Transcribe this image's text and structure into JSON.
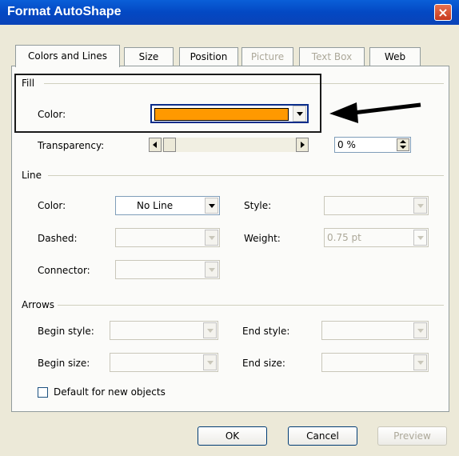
{
  "window": {
    "title": "Format AutoShape",
    "close_glyph": "×"
  },
  "tabs": [
    {
      "label": "Colors and Lines",
      "active": true
    },
    {
      "label": "Size"
    },
    {
      "label": "Position"
    },
    {
      "label": "Picture",
      "disabled": true
    },
    {
      "label": "Text Box",
      "disabled": true
    },
    {
      "label": "Web"
    }
  ],
  "fill": {
    "group_label": "Fill",
    "color_label": "Color:",
    "color_value_hex": "#ff9900",
    "transparency_label": "Transparency:",
    "transparency_value": "0 %"
  },
  "line": {
    "group_label": "Line",
    "color_label": "Color:",
    "color_value": "No Line",
    "style_label": "Style:",
    "dashed_label": "Dashed:",
    "weight_label": "Weight:",
    "weight_value": "0.75 pt",
    "connector_label": "Connector:"
  },
  "arrows": {
    "group_label": "Arrows",
    "begin_style_label": "Begin style:",
    "end_style_label": "End style:",
    "begin_size_label": "Begin size:",
    "end_size_label": "End size:"
  },
  "default_checkbox": {
    "label": "Default for new objects",
    "checked": false
  },
  "buttons": {
    "ok": "OK",
    "cancel": "Cancel",
    "preview": "Preview"
  },
  "colors": {
    "highlight_box": "#1a1a1a",
    "arrow": "#000000",
    "fill_color": "#ff9900"
  }
}
